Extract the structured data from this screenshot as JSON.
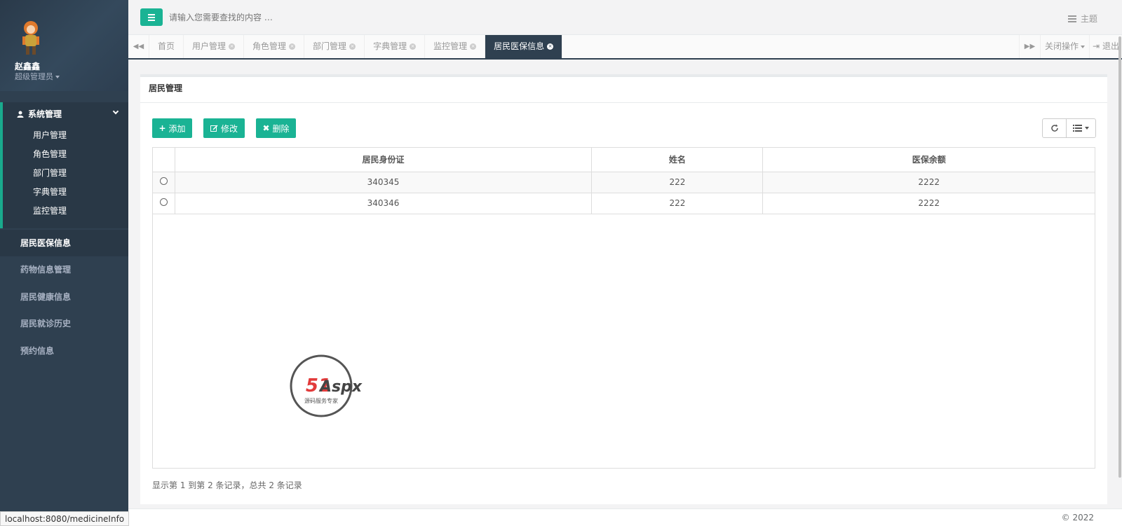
{
  "sidebar": {
    "user_name": "赵鑫鑫",
    "user_role": "超级管理员",
    "group": {
      "label": "系统管理",
      "items": [
        "用户管理",
        "角色管理",
        "部门管理",
        "字典管理",
        "监控管理"
      ]
    },
    "items": [
      "居民医保信息",
      "药物信息管理",
      "居民健康信息",
      "居民就诊历史",
      "预约信息"
    ],
    "active_item": "居民医保信息"
  },
  "header": {
    "search_placeholder": "请输入您需要查找的内容 …",
    "theme_label": "主题"
  },
  "tabs": {
    "items": [
      {
        "label": "首页",
        "closable": false
      },
      {
        "label": "用户管理",
        "closable": true
      },
      {
        "label": "角色管理",
        "closable": true
      },
      {
        "label": "部门管理",
        "closable": true
      },
      {
        "label": "字典管理",
        "closable": true
      },
      {
        "label": "监控管理",
        "closable": true
      },
      {
        "label": "居民医保信息",
        "closable": true,
        "active": true
      }
    ],
    "close_ops_label": "关闭操作",
    "logout_label": "退出"
  },
  "panel": {
    "title": "居民管理",
    "buttons": {
      "add": "添加",
      "edit": "修改",
      "delete": "删除"
    },
    "columns": [
      "居民身份证",
      "姓名",
      "医保余额"
    ],
    "rows": [
      [
        "340345",
        "222",
        "2222"
      ],
      [
        "340346",
        "222",
        "2222"
      ]
    ],
    "pager_info": "显示第 1 到第 2 条记录，总共 2 条记录"
  },
  "watermark": {
    "brand": "51Aspx",
    "tagline": "源码服务专家"
  },
  "footer": {
    "copyright": "© 2022"
  },
  "status_bar": {
    "url": "localhost:8080/medicineInfo"
  },
  "colors": {
    "sidebar": "#2f4050",
    "accent": "#1ab394",
    "active_tab": "#2f4050"
  }
}
